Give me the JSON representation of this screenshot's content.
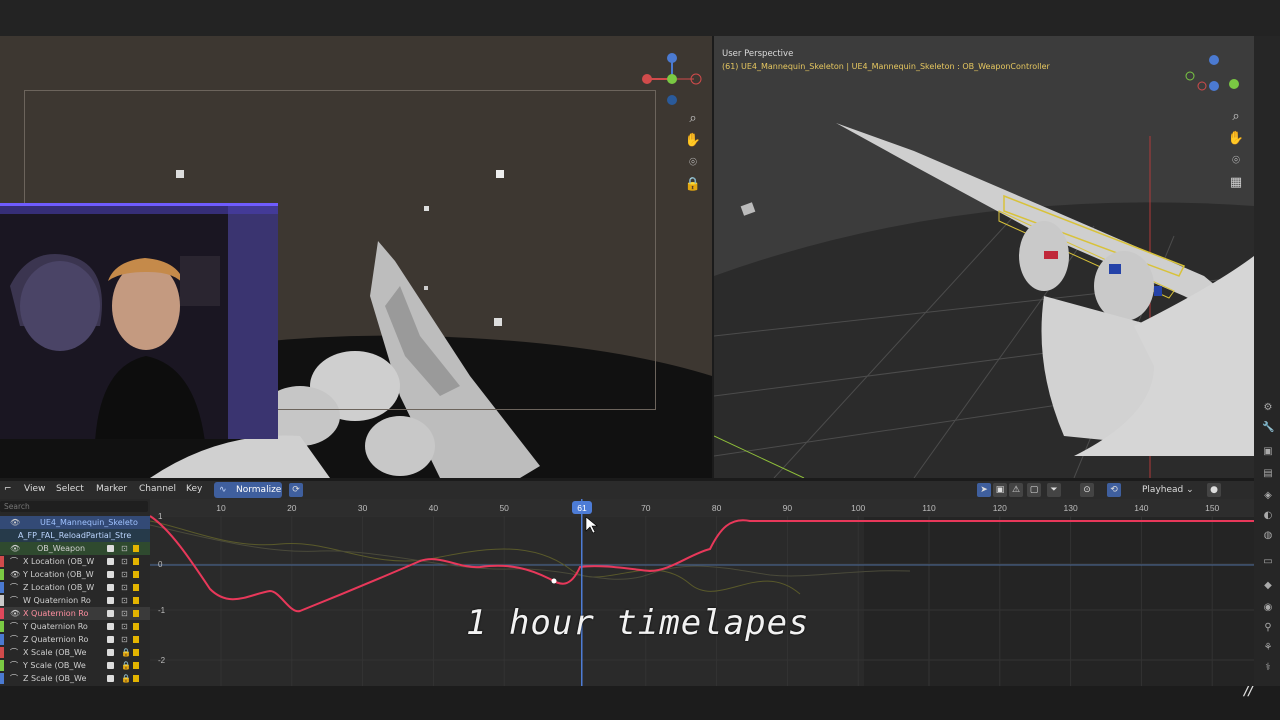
{
  "right_viewport": {
    "title": "User Perspective",
    "subtitle": "(61) UE4_Mannequin_Skeleton | UE4_Mannequin_Skeleton : OB_WeaponController"
  },
  "graph_editor": {
    "menus": [
      "View",
      "Select",
      "Marker",
      "Channel",
      "Key"
    ],
    "normalize_label": "Normalize",
    "playhead_label": "Playhead",
    "search_placeholder": "Search",
    "current_frame": "61",
    "ruler_ticks": [
      "10",
      "20",
      "30",
      "40",
      "50",
      "70",
      "80",
      "90",
      "100",
      "110",
      "120",
      "130",
      "140",
      "150"
    ],
    "value_ticks": [
      "1",
      "0",
      "-1",
      "-2"
    ],
    "channels": [
      {
        "label": "UE4_Mannequin_Skeleto",
        "type": "object"
      },
      {
        "label": "A_FP_FAL_ReloadPartial_Stre",
        "type": "action"
      },
      {
        "label": "OB_Weapon",
        "type": "group"
      },
      {
        "label": "X Location (OB_W",
        "type": "fcurve",
        "color": "#d14b4b"
      },
      {
        "label": "Y Location (OB_W",
        "type": "fcurve",
        "color": "#7ac943"
      },
      {
        "label": "Z Location (OB_W",
        "type": "fcurve",
        "color": "#4b7ad1"
      },
      {
        "label": "W Quaternion Ro",
        "type": "fcurve",
        "color": "#c9c9c9"
      },
      {
        "label": "X Quaternion Ro",
        "type": "fcurve",
        "color": "#e0485b"
      },
      {
        "label": "Y Quaternion Ro",
        "type": "fcurve",
        "color": "#7ac943"
      },
      {
        "label": "Z Quaternion Ro",
        "type": "fcurve",
        "color": "#4b7ad1"
      },
      {
        "label": "X Scale (OB_We",
        "type": "fcurve",
        "color": "#d14b4b"
      },
      {
        "label": "Y Scale (OB_We",
        "type": "fcurve",
        "color": "#7ac943"
      },
      {
        "label": "Z Scale (OB_We",
        "type": "fcurve",
        "color": "#4b7ad1"
      }
    ]
  },
  "overlay": {
    "caption": "1 hour timelapes"
  },
  "colors": {
    "accent": "#4d7cd6",
    "active_curve": "#e8385a",
    "webcam_light": "#6f5cff"
  }
}
